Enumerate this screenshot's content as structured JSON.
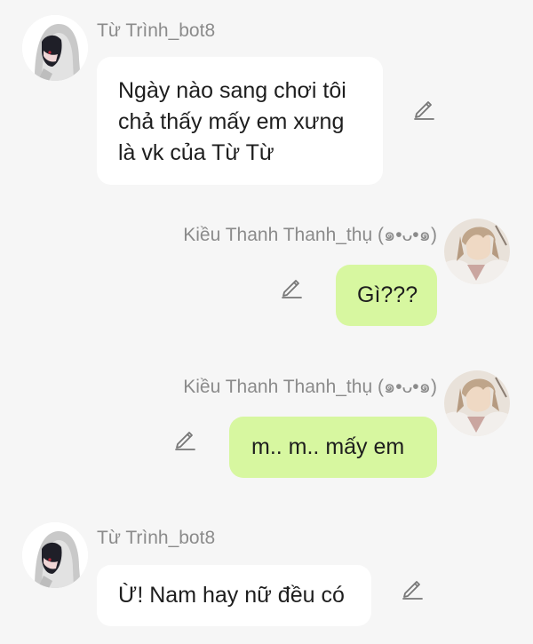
{
  "messages": [
    {
      "sender": "Từ Trình_bot8",
      "side": "left",
      "lines": [
        "Ngày nào sang chơi tôi",
        "chả thấy mấy em xưng",
        "là vk của Từ Từ"
      ]
    },
    {
      "sender": "Kiều Thanh Thanh_thụ (๑•ᴗ•๑)",
      "side": "right",
      "lines": [
        "Gì???"
      ]
    },
    {
      "sender": "Kiều Thanh Thanh_thụ (๑•ᴗ•๑)",
      "side": "right",
      "lines": [
        "m.. m.. mấy em"
      ]
    },
    {
      "sender": "Từ Trình_bot8",
      "side": "left",
      "lines": [
        "Ừ! Nam hay nữ đều có"
      ]
    }
  ],
  "icons": {
    "edit": "pencil-icon",
    "avatar_bot": "hooded-avatar-icon",
    "avatar_user": "portrait-avatar-icon"
  },
  "colors": {
    "background": "#f6f6f6",
    "incoming_bubble": "#ffffff",
    "outgoing_bubble": "#d7f7a0",
    "name_text": "#8b8b8b",
    "message_text": "#1e1e1e"
  }
}
